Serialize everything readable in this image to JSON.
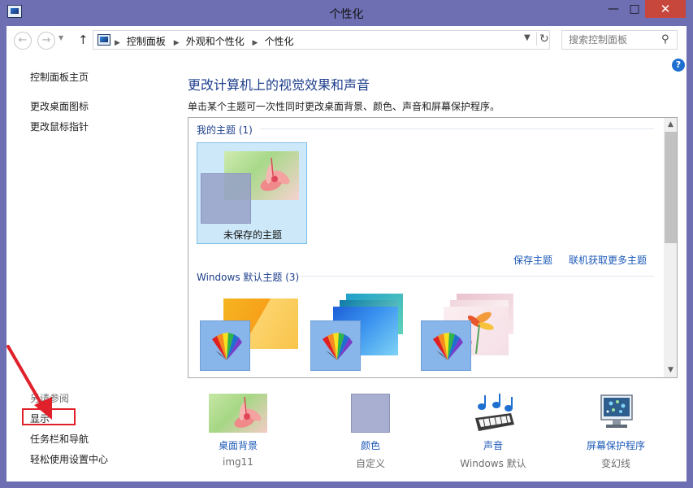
{
  "window": {
    "title": "个性化",
    "minimize": "—",
    "maximize": "□",
    "close": "✕"
  },
  "navigation": {
    "back": "←",
    "forward": "→",
    "up": "↑",
    "breadcrumbs": [
      "控制面板",
      "外观和个性化",
      "个性化"
    ],
    "search_placeholder": "搜索控制面板"
  },
  "sidebar": {
    "items": [
      {
        "label": "控制面板主页"
      },
      {
        "label": "更改桌面图标"
      },
      {
        "label": "更改鼠标指针"
      }
    ],
    "see_also_label": "另请参阅",
    "see_also_items": [
      {
        "label": "显示"
      },
      {
        "label": "任务栏和导航"
      },
      {
        "label": "轻松使用设置中心"
      }
    ]
  },
  "main": {
    "title": "更改计算机上的视觉效果和声音",
    "description": "单击某个主题可一次性同时更改桌面背景、颜色、声音和屏幕保护程序。",
    "my_themes": {
      "heading": "我的主题 (1)",
      "items": [
        {
          "label": "未保存的主题"
        }
      ],
      "save_link": "保存主题",
      "more_link": "联机获取更多主题"
    },
    "windows_themes": {
      "heading": "Windows 默认主题 (3)"
    }
  },
  "bottom": {
    "items": [
      {
        "label": "桌面背景",
        "value": "img11",
        "icon": "flower-wallpaper-icon"
      },
      {
        "label": "颜色",
        "value": "自定义",
        "icon": "color-swatch-icon"
      },
      {
        "label": "声音",
        "value": "Windows 默认",
        "icon": "music-notes-icon"
      },
      {
        "label": "屏幕保护程序",
        "value": "变幻线",
        "icon": "monitor-icon"
      }
    ]
  },
  "colors": {
    "accent_link": "#1d5ab8",
    "heading_blue": "#1d3e8c",
    "frame": "#6e6eb3",
    "annotation_red": "#e0202a"
  }
}
